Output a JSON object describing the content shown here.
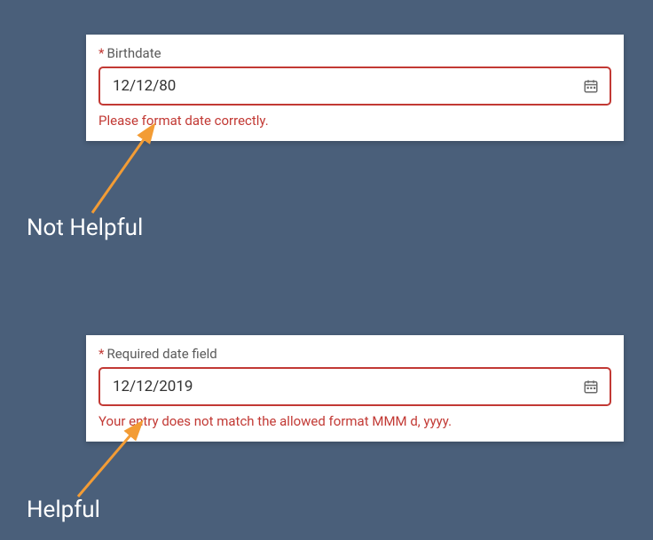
{
  "examples": {
    "bad": {
      "label": "Birthdate",
      "required_marker": "*",
      "value": "12/12/80",
      "error": "Please format date correctly.",
      "annotation": "Not Helpful"
    },
    "good": {
      "label": "Required date field",
      "required_marker": "*",
      "value": "12/12/2019",
      "error": "Your entry does not match the allowed format MMM d, yyyy.",
      "annotation": "Helpful"
    }
  },
  "colors": {
    "background": "#4a5f7a",
    "error": "#c23934",
    "arrow": "#f39c35"
  }
}
